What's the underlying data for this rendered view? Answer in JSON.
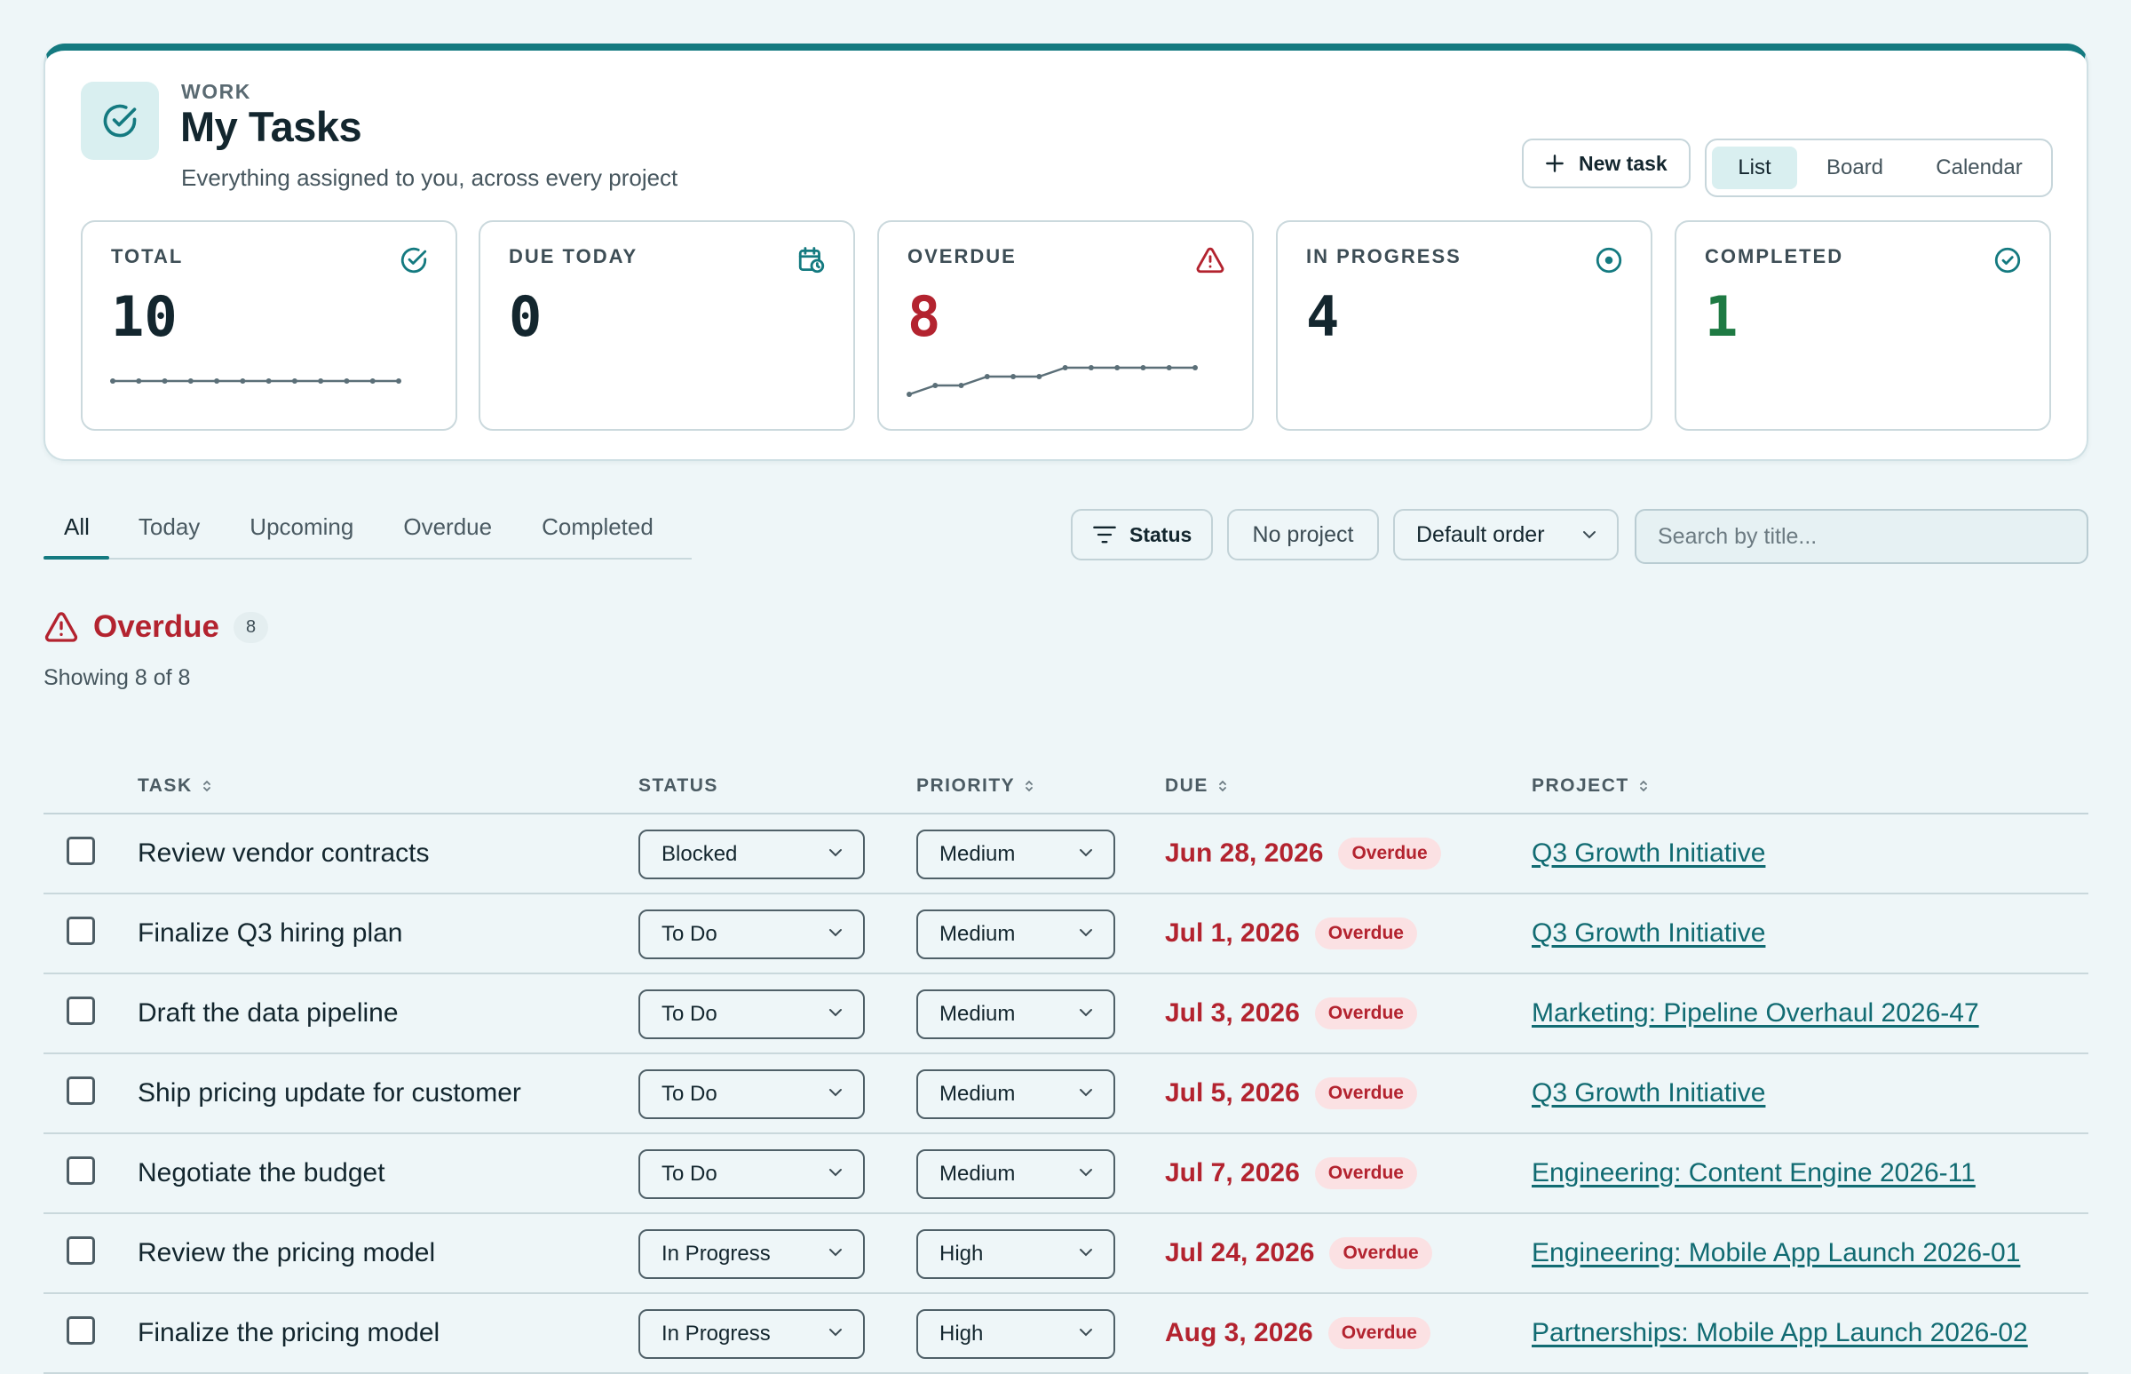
{
  "header": {
    "eyebrow": "WORK",
    "title": "My Tasks",
    "subtitle": "Everything assigned to you, across every project",
    "icon": "check-circle-icon",
    "new_task_label": "New task",
    "views": [
      "List",
      "Board",
      "Calendar"
    ],
    "active_view": "List",
    "accent_color": "#147a80"
  },
  "stats": {
    "total": {
      "label": "TOTAL",
      "value": "10",
      "icon": "check-circle-icon",
      "trend": [
        10,
        10,
        10,
        10,
        10,
        10,
        10,
        10,
        10,
        10,
        10,
        10
      ]
    },
    "due_today": {
      "label": "DUE TODAY",
      "value": "0",
      "icon": "calendar-clock-icon"
    },
    "overdue": {
      "label": "OVERDUE",
      "value": "8",
      "icon": "warning-triangle-icon",
      "color": "#b3232f",
      "trend": [
        1,
        2,
        2,
        3,
        3,
        3,
        4,
        4,
        4,
        4,
        4,
        4
      ]
    },
    "in_progress": {
      "label": "IN PROGRESS",
      "value": "4",
      "icon": "clock-dot-icon"
    },
    "completed": {
      "label": "COMPLETED",
      "value": "1",
      "icon": "check-circle-icon",
      "color": "#1e7a43"
    }
  },
  "tabs": [
    "All",
    "Today",
    "Upcoming",
    "Overdue",
    "Completed"
  ],
  "active_tab": "All",
  "filters": {
    "status_label": "Status",
    "project_label": "No project",
    "order_label": "Default order",
    "search_placeholder": "Search by title..."
  },
  "section": {
    "title": "Overdue",
    "count": "8",
    "showing": "Showing 8 of 8",
    "color": "#b3232f"
  },
  "columns": {
    "task": "TASK",
    "status": "STATUS",
    "priority": "PRIORITY",
    "due": "DUE",
    "project": "PROJECT"
  },
  "rows": [
    {
      "task": "Review vendor contracts",
      "status": "Blocked",
      "priority": "Medium",
      "due": "Jun 28, 2026",
      "badge": "Overdue",
      "project": "Q3 Growth Initiative"
    },
    {
      "task": "Finalize Q3 hiring plan",
      "status": "To Do",
      "priority": "Medium",
      "due": "Jul 1, 2026",
      "badge": "Overdue",
      "project": "Q3 Growth Initiative"
    },
    {
      "task": "Draft the data pipeline",
      "status": "To Do",
      "priority": "Medium",
      "due": "Jul 3, 2026",
      "badge": "Overdue",
      "project": "Marketing: Pipeline Overhaul 2026-47"
    },
    {
      "task": "Ship pricing update for customer",
      "status": "To Do",
      "priority": "Medium",
      "due": "Jul 5, 2026",
      "badge": "Overdue",
      "project": "Q3 Growth Initiative"
    },
    {
      "task": "Negotiate the budget",
      "status": "To Do",
      "priority": "Medium",
      "due": "Jul 7, 2026",
      "badge": "Overdue",
      "project": "Engineering: Content Engine 2026-11"
    },
    {
      "task": "Review the pricing model",
      "status": "In Progress",
      "priority": "High",
      "due": "Jul 24, 2026",
      "badge": "Overdue",
      "project": "Engineering: Mobile App Launch 2026-01"
    },
    {
      "task": "Finalize the pricing model",
      "status": "In Progress",
      "priority": "High",
      "due": "Aug 3, 2026",
      "badge": "Overdue",
      "project": "Partnerships: Mobile App Launch 2026-02"
    }
  ]
}
